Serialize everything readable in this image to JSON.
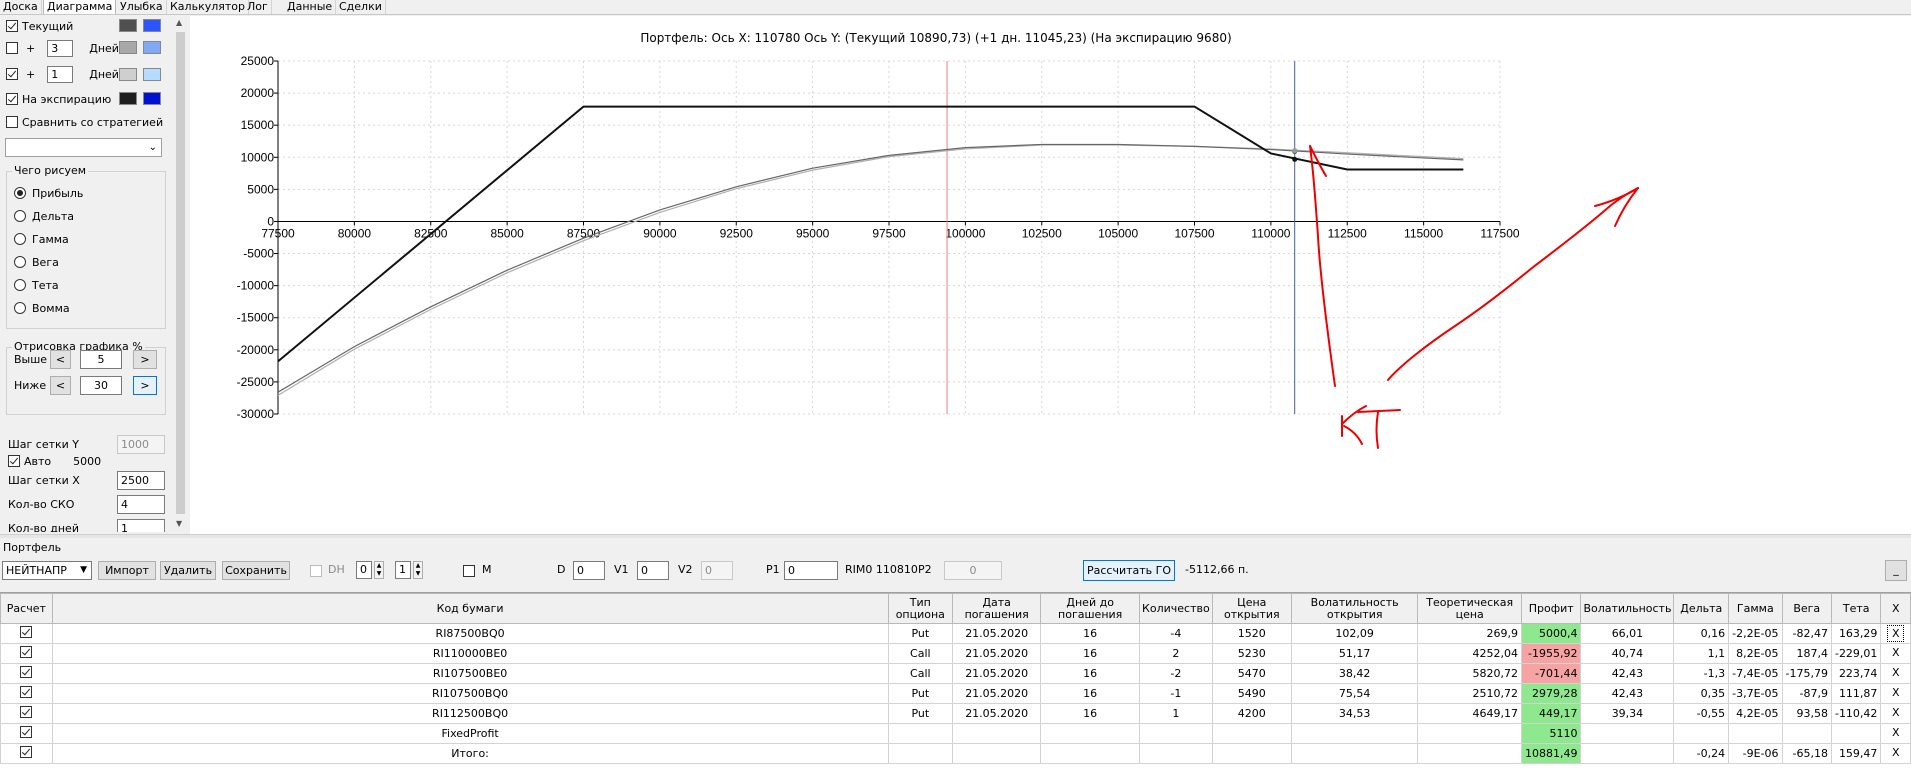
{
  "tabs": [
    "Доска",
    "Диаграмма",
    "Улыбка",
    "Калькулятор",
    "Лог",
    "Данные",
    "Сделки"
  ],
  "active_tab": "Диаграмма",
  "left": {
    "current_label": "Текущий",
    "plus_sign": "+",
    "days_label": "Дней",
    "days1": "3",
    "days2": "1",
    "expiry_label": "На экспирацию",
    "compare_label": "Сравнить со стратегией",
    "colors": {
      "current": [
        "#505050",
        "#2a55ff"
      ],
      "days1": [
        "#a8a8a8",
        "#7fa9f5"
      ],
      "days2": [
        "#cfcfcf",
        "#b5dcff"
      ],
      "expiry": [
        "#1e1e1e",
        "#0010d0"
      ]
    },
    "what_title": "Чего рисуем",
    "what_options": [
      "Прибыль",
      "Дельта",
      "Гамма",
      "Вега",
      "Тета",
      "Вомма"
    ],
    "draw_title": "Отрисовка графика %",
    "above_label": "Выше",
    "above_value": "5",
    "below_label": "Ниже",
    "below_value": "30",
    "lt": "<",
    "gt": ">",
    "grid_y_label": "Шаг сетки Y",
    "grid_y_value": "1000",
    "auto_label": "Авто",
    "auto_value": "5000",
    "grid_x_label": "Шаг сетки X",
    "grid_x_value": "2500",
    "sko_label": "Кол-во СКО",
    "sko_value": "4",
    "days_count_label": "Кол-во дней",
    "days_count_value": "1"
  },
  "chart_data": {
    "type": "line",
    "title": "Портфель: Ось X: 110780 Ось Y:  (Текущий 10890,73)  (+1 дн. 11045,23)  (На экспирацию 9680)",
    "xlim": [
      77500,
      117500
    ],
    "ylim": [
      -30000,
      25000
    ],
    "x_ticks": [
      77500,
      80000,
      82500,
      85000,
      87500,
      90000,
      92500,
      95000,
      97500,
      100000,
      102500,
      105000,
      107500,
      110000,
      112500,
      115000,
      117500
    ],
    "y_ticks": [
      25000,
      20000,
      15000,
      10000,
      5000,
      0,
      -5000,
      -10000,
      -15000,
      -20000,
      -25000,
      -30000
    ],
    "grid": true,
    "cursor_x": 110780,
    "red_marker_x": 99400,
    "series": [
      {
        "color": "#111111",
        "points": [
          [
            77500,
            -21800
          ],
          [
            87500,
            17900
          ],
          [
            107500,
            17900
          ],
          [
            110000,
            10600
          ],
          [
            112500,
            8100
          ],
          [
            116300,
            8100
          ]
        ]
      },
      {
        "color": "#666666",
        "points": [
          [
            77500,
            -26600
          ],
          [
            80000,
            -19500
          ],
          [
            82500,
            -13300
          ],
          [
            85000,
            -7600
          ],
          [
            87500,
            -2600
          ],
          [
            90000,
            1800
          ],
          [
            92500,
            5400
          ],
          [
            95000,
            8300
          ],
          [
            97500,
            10300
          ],
          [
            100000,
            11500
          ],
          [
            102500,
            12000
          ],
          [
            105000,
            12000
          ],
          [
            107500,
            11700
          ],
          [
            110000,
            11200
          ],
          [
            112500,
            10500
          ],
          [
            115000,
            9900
          ],
          [
            116300,
            9600
          ]
        ]
      },
      {
        "color": "#b0b0b0",
        "points": [
          [
            77500,
            -27100
          ],
          [
            80000,
            -19900
          ],
          [
            82500,
            -13700
          ],
          [
            85000,
            -8000
          ],
          [
            87500,
            -3000
          ],
          [
            90000,
            1400
          ],
          [
            92500,
            5100
          ],
          [
            95000,
            8000
          ],
          [
            97500,
            10100
          ],
          [
            100000,
            11300
          ],
          [
            102500,
            11900
          ],
          [
            105000,
            11900
          ],
          [
            107500,
            11700
          ],
          [
            110000,
            11300
          ],
          [
            112500,
            10700
          ],
          [
            115000,
            10100
          ],
          [
            116300,
            9800
          ]
        ]
      }
    ],
    "markers": [
      {
        "x": 110780,
        "y": 9680,
        "color": "#111111"
      },
      {
        "x": 110780,
        "y": 10890,
        "color": "#555555"
      },
      {
        "x": 110780,
        "y": 11045,
        "color": "#999999"
      }
    ]
  },
  "annotation": {
    "text": "КТ",
    "color": "#ee0000"
  },
  "portfolio": {
    "label": "Портфель",
    "strategy": "НЕЙТНАПР",
    "import": "Импорт",
    "delete": "Удалить",
    "save": "Сохранить",
    "dh_label": "DH",
    "dh_value1": "0",
    "dh_value2": "1",
    "m_label": "M",
    "d_label": "D",
    "d_value": "0",
    "v1_label": "V1",
    "v1_value": "0",
    "v2_label": "V2",
    "v2_value": "0",
    "p1_label": "P1",
    "p1_value": "0",
    "rim_text": "RIM0 110810",
    "p2_label": "P2",
    "p2_value": "0",
    "calc_button": "Рассчитать ГО",
    "go_value": "-5112,66 п.",
    "min_button": "_"
  },
  "table": {
    "headers": [
      "Расчет",
      "Код бумаги",
      "Тип опциона",
      "Дата погашения",
      "Дней до погашения",
      "Количество",
      "Цена открытия",
      "Волатильность открытия",
      "Теоретическая цена",
      "Профит",
      "Волатильность",
      "Дельта",
      "Гамма",
      "Вега",
      "Тета",
      "X"
    ],
    "rows": [
      {
        "code": "RI87500BQ0",
        "type": "Put",
        "date": "21.05.2020",
        "days": "16",
        "qty": "-4",
        "price": "1520",
        "vol_open": "102,09",
        "theo": "269,9",
        "profit": "5000,4",
        "profit_color": "#8ee88e",
        "vol": "66,01",
        "delta": "0,16",
        "gamma": "-2,2E-05",
        "vega": "-82,47",
        "theta": "163,29",
        "x": "X"
      },
      {
        "code": "RI110000BE0",
        "type": "Call",
        "date": "21.05.2020",
        "days": "16",
        "qty": "2",
        "price": "5230",
        "vol_open": "51,17",
        "theo": "4252,04",
        "profit": "-1955,92",
        "profit_color": "#f5a3a3",
        "vol": "40,74",
        "delta": "1,1",
        "gamma": "8,2E-05",
        "vega": "187,4",
        "theta": "-229,01",
        "x": "X"
      },
      {
        "code": "RI107500BE0",
        "type": "Call",
        "date": "21.05.2020",
        "days": "16",
        "qty": "-2",
        "price": "5470",
        "vol_open": "38,42",
        "theo": "5820,72",
        "profit": "-701,44",
        "profit_color": "#f5a3a3",
        "vol": "42,43",
        "delta": "-1,3",
        "gamma": "-7,4E-05",
        "vega": "-175,79",
        "theta": "223,74",
        "x": "X"
      },
      {
        "code": "RI107500BQ0",
        "type": "Put",
        "date": "21.05.2020",
        "days": "16",
        "qty": "-1",
        "price": "5490",
        "vol_open": "75,54",
        "theo": "2510,72",
        "profit": "2979,28",
        "profit_color": "#8ee88e",
        "vol": "42,43",
        "delta": "0,35",
        "gamma": "-3,7E-05",
        "vega": "-87,9",
        "theta": "111,87",
        "x": "X"
      },
      {
        "code": "RI112500BQ0",
        "type": "Put",
        "date": "21.05.2020",
        "days": "16",
        "qty": "1",
        "price": "4200",
        "vol_open": "34,53",
        "theo": "4649,17",
        "profit": "449,17",
        "profit_color": "#8ee88e",
        "vol": "39,34",
        "delta": "-0,55",
        "gamma": "4,2E-05",
        "vega": "93,58",
        "theta": "-110,42",
        "x": "X"
      },
      {
        "code": "FixedProfit",
        "type": "",
        "date": "",
        "days": "",
        "qty": "",
        "price": "",
        "vol_open": "",
        "theo": "",
        "profit": "5110",
        "profit_color": "#8ee88e",
        "vol": "",
        "delta": "",
        "gamma": "",
        "vega": "",
        "theta": "",
        "x": "X"
      },
      {
        "code": "Итого:",
        "type": "",
        "date": "",
        "days": "",
        "qty": "",
        "price": "",
        "vol_open": "",
        "theo": "",
        "profit": "10881,49",
        "profit_color": "#8ee88e",
        "vol": "",
        "delta": "-0,24",
        "gamma": "-9E-06",
        "vega": "-65,18",
        "theta": "159,47",
        "x": "X"
      }
    ]
  }
}
